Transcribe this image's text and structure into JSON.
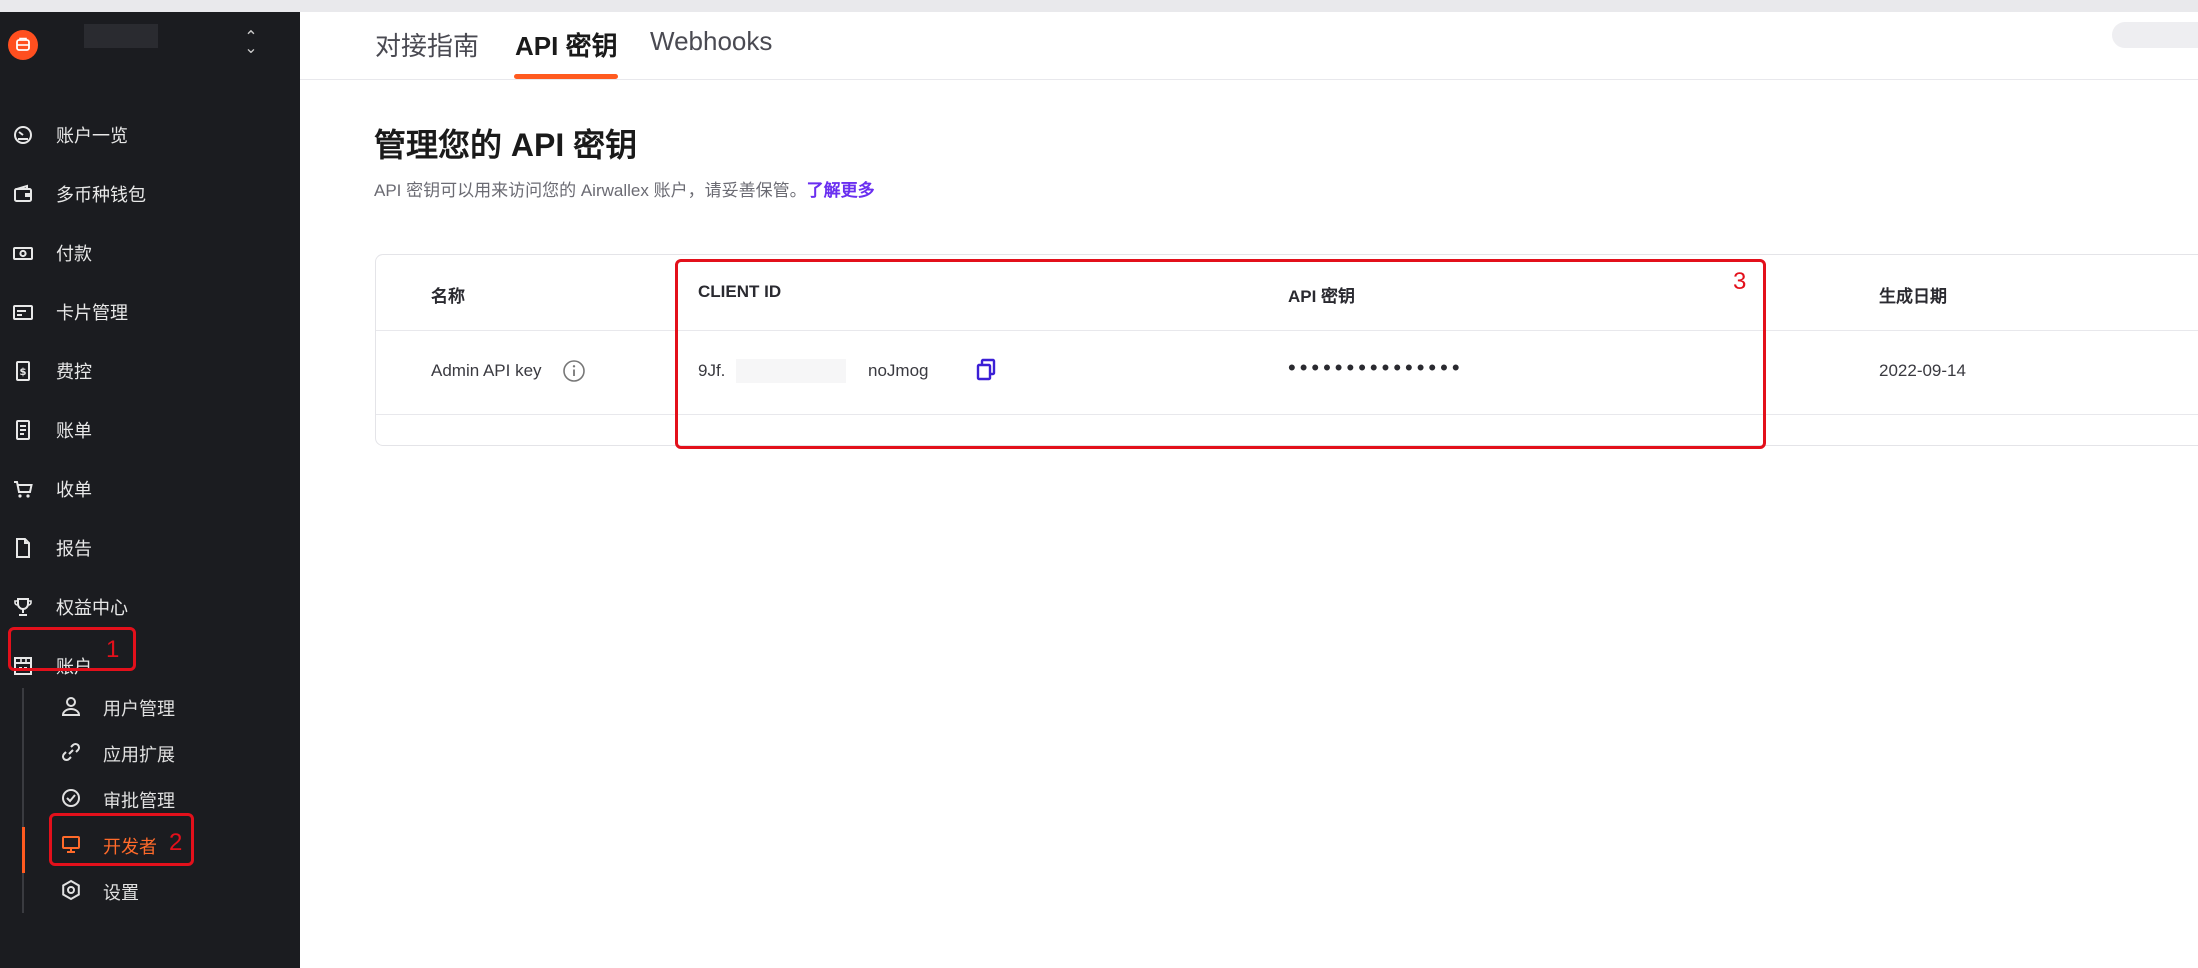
{
  "sidebar": {
    "items": [
      {
        "label": "账户一览",
        "icon": "gauge-icon"
      },
      {
        "label": "多币种钱包",
        "icon": "wallet-icon"
      },
      {
        "label": "付款",
        "icon": "banknote-icon"
      },
      {
        "label": "卡片管理",
        "icon": "card-icon"
      },
      {
        "label": "费控",
        "icon": "expense-icon"
      },
      {
        "label": "账单",
        "icon": "bill-icon"
      },
      {
        "label": "收单",
        "icon": "cart-icon"
      },
      {
        "label": "报告",
        "icon": "document-icon"
      },
      {
        "label": "权益中心",
        "icon": "trophy-icon"
      },
      {
        "label": "账户",
        "icon": "store-icon"
      }
    ],
    "sub_items": [
      {
        "label": "用户管理",
        "icon": "user-icon"
      },
      {
        "label": "应用扩展",
        "icon": "link-icon"
      },
      {
        "label": "审批管理",
        "icon": "check-circle-icon"
      },
      {
        "label": "开发者",
        "icon": "monitor-icon",
        "active": true
      },
      {
        "label": "设置",
        "icon": "settings-icon"
      }
    ]
  },
  "annotations": [
    "1",
    "2",
    "3"
  ],
  "tabs": [
    {
      "label": "对接指南"
    },
    {
      "label": "API 密钥",
      "active": true
    },
    {
      "label": "Webhooks"
    }
  ],
  "page": {
    "title": "管理您的 API 密钥",
    "description": "API 密钥可以用来访问您的 Airwallex 账户，请妥善保管。",
    "learn_more": "了解更多"
  },
  "table": {
    "headers": [
      "名称",
      "CLIENT ID",
      "API 密钥",
      "生成日期"
    ],
    "rows": [
      {
        "name": "Admin API key",
        "client_id_start": "9Jf.",
        "client_id_end": "noJmog",
        "api_key": "•••••••••••••••",
        "date": "2022-09-14"
      }
    ]
  },
  "colors": {
    "accent": "#ff5a1f",
    "annotation": "#e3101b",
    "link": "#6a2ff0",
    "sidebar_bg": "#1b1c20"
  }
}
